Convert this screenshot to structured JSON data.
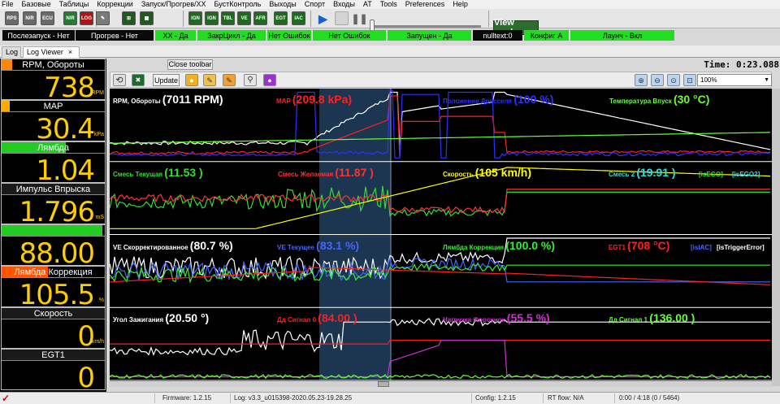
{
  "menu": [
    "File",
    "Базовые",
    "Таблицы",
    "Коррекции",
    "Запуск/Прогрев/ХХ",
    "БустКонтроль",
    "Выходы",
    "Спорт",
    "Входы",
    "AT",
    "Tools",
    "Preferences",
    "Help"
  ],
  "toolbar": {
    "buttons": [
      {
        "name": "burn-icon",
        "label": "RPS",
        "color": "#6a6a6a"
      },
      {
        "name": "nr-icon",
        "label": "N/R",
        "color": "#6a6a6a"
      },
      {
        "name": "ecu-icon",
        "label": "ECU",
        "color": "#6a6a6a"
      },
      {
        "name": "nr2-icon",
        "label": "N/R",
        "color": "#1f7f2a"
      },
      {
        "name": "log-icon",
        "label": "LOG",
        "color": "#b01515"
      },
      {
        "name": "tools-icon",
        "label": "✎",
        "color": "#7a7a7a"
      },
      {
        "name": "gauge-cluster-icon",
        "label": "⊞",
        "color": "#1f5a1f"
      },
      {
        "name": "table-icon",
        "label": "▦",
        "color": "#1f5a1f"
      },
      {
        "name": "tbl-ign-icon",
        "label": "IGN",
        "color": "#1f6a1f"
      },
      {
        "name": "tbl-ign2-icon",
        "label": "IGN",
        "color": "#1f6a1f"
      },
      {
        "name": "tbl-tbl-icon",
        "label": "TBL",
        "color": "#1f6a1f"
      },
      {
        "name": "tbl-ve-icon",
        "label": "VE",
        "color": "#1f6a1f"
      },
      {
        "name": "tbl-afr-icon",
        "label": "AFR",
        "color": "#1f6a1f"
      },
      {
        "name": "tbl-egt-icon",
        "label": "EGT",
        "color": "#1f6a1f"
      },
      {
        "name": "tbl-iac-icon",
        "label": "IAC",
        "color": "#1f6a1f"
      },
      {
        "name": "tbl-ego-icon",
        "label": "EGO",
        "color": "#1f6a1f"
      }
    ],
    "view_mode_label": "View mode"
  },
  "status_indicators": [
    {
      "text": "Послезапуск - Нет",
      "style": "k"
    },
    {
      "text": "Прогрев - Нет",
      "style": "k"
    },
    {
      "text": "ХХ - Да",
      "style": "g"
    },
    {
      "text": "ЗакрЦикл - Да",
      "style": "g"
    },
    {
      "text": "Нет Ошибок",
      "style": "g"
    },
    {
      "text": "Нет Ошибок",
      "style": "g"
    },
    {
      "text": "Запущен - Да",
      "style": "g"
    },
    {
      "text": "nulltext:0",
      "style": "k"
    },
    {
      "text": "Конфиг А",
      "style": "g"
    },
    {
      "text": "Лаунч - Вкл",
      "style": "g"
    }
  ],
  "tabs": [
    {
      "label": "Log",
      "active": false
    },
    {
      "label": "Log Viewer",
      "active": true,
      "closable": "×"
    }
  ],
  "gauges": [
    {
      "label": "RPM, Обороты",
      "value": "738",
      "unit": "RPM",
      "bar_color": "#ff8800",
      "bar_fraction": 0.1
    },
    {
      "label": "MAP",
      "value": "30.4",
      "unit": "kPa",
      "bar_color": "#ffaa00",
      "bar_fraction": 0.08
    },
    {
      "label": "Лямбда",
      "value": "1.04",
      "unit": "",
      "bar_color": "#22cc22",
      "bar_fraction": 0.62
    },
    {
      "label": "Импульс Впрыска",
      "value": "1.796",
      "unit": "mS",
      "bar_color": "#22cc22",
      "bar_fraction": 0.0
    },
    {
      "label": "",
      "value": "88.00",
      "unit": "",
      "bar_color": "#22cc22",
      "bar_fraction": 0.98
    },
    {
      "label": "Лямбда Коррекция",
      "value": "105.5",
      "unit": "%",
      "bar_color": "#ff5500",
      "bar_fraction": 0.45
    },
    {
      "label": "Скорость",
      "value": "0",
      "unit": "km/h",
      "bar_color": "#22cc22",
      "bar_fraction": 0.0
    },
    {
      "label": "EGT1",
      "value": "0",
      "unit": "",
      "bar_color": "#22cc22",
      "bar_fraction": 0.0
    }
  ],
  "logviewer": {
    "close_toolbar_label": "Close toolbar",
    "time_label": "Time:",
    "time_value": "0:23.088",
    "update_label": "Update",
    "zoom_value": "100%",
    "toolbar_icons": [
      "refresh-icon",
      "excel-icon",
      "update-button",
      "open-icon",
      "edit-icon",
      "clear-icon",
      "search-icon",
      "record-icon"
    ],
    "zoom_icons": [
      "zoom-in-icon",
      "zoom-out-icon",
      "zoom-fit-icon",
      "zoom-reset-icon"
    ]
  },
  "chart_data": {
    "type": "line",
    "title": "",
    "panels": [
      {
        "labels": [
          {
            "name": "RPM, Обороты",
            "value": "(7011 RPM)",
            "color": "#ffffff"
          },
          {
            "name": "MAP",
            "value": "(209.8 kPa)",
            "color": "#ff2020"
          },
          {
            "name": "Положение Дросселя",
            "value": "(100 %)",
            "color": "#3030ff"
          },
          {
            "name": "Температура Впуск",
            "value": "(30 °C)",
            "color": "#66ff33"
          }
        ]
      },
      {
        "labels": [
          {
            "name": "Смесь Текущая",
            "value": "(11.53 )",
            "color": "#33dd33"
          },
          {
            "name": "Смесь Желаемая",
            "value": "(11.87 )",
            "color": "#ff3333"
          },
          {
            "name": "Скорость",
            "value": "(105 km/h)",
            "color": "#ffff00"
          },
          {
            "name": "Смесь 2",
            "value": "(19.91 )",
            "color": "#33dddd"
          },
          {
            "name": "[isEGO]",
            "value": "",
            "color": "#33dd33"
          },
          {
            "name": "[isEGO2]",
            "value": "",
            "color": "#33dddd"
          }
        ]
      },
      {
        "labels": [
          {
            "name": "VE Скорректированное",
            "value": "(80.7 %)",
            "color": "#ffffff"
          },
          {
            "name": "VE Текущее",
            "value": "(83.1 %)",
            "color": "#4466ff"
          },
          {
            "name": "Лямбда Коррекция",
            "value": "(100.0 %)",
            "color": "#33ee33"
          },
          {
            "name": "EGT1",
            "value": "(708 °C)",
            "color": "#ff2020"
          },
          {
            "name": "[isIAC]",
            "value": "",
            "color": "#4466ff"
          },
          {
            "name": "[isTriggerError]",
            "value": "",
            "color": "#ffffff"
          }
        ]
      },
      {
        "labels": [
          {
            "name": "Угол Зажигания",
            "value": "(20.50 °)",
            "color": "#ffffff"
          },
          {
            "name": "Дд Сигнал 0",
            "value": "(84.00 )",
            "color": "#ff2020"
          },
          {
            "name": "Нагрузка Форсунок",
            "value": "(55.5 %)",
            "color": "#cc33cc"
          },
          {
            "name": "Дд Сигнал 1",
            "value": "(136.00 )",
            "color": "#66ff33"
          }
        ]
      }
    ]
  },
  "statusbar": {
    "check_icon": "✓",
    "firmware": "Firmware: 1.2.15",
    "log": "Log: v3.3_u015398-2020.05.23-19.28.25",
    "config": "Config: 1.2.15",
    "rt_flow": "RT flow: N/A",
    "position": "0:00 / 4:18 (0 / 5464)"
  }
}
